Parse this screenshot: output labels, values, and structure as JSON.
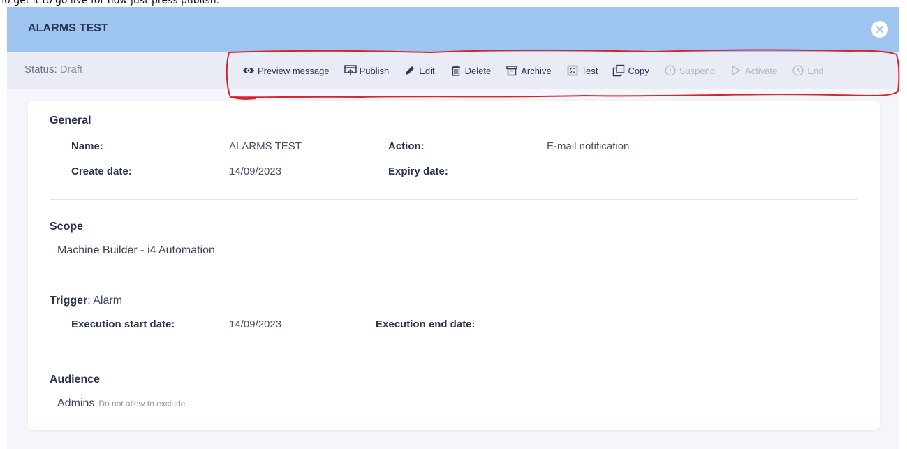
{
  "caption": "To get it to go live for now just press publish.",
  "header": {
    "title": "ALARMS TEST"
  },
  "status": {
    "label": "Status:",
    "value": "Draft"
  },
  "toolbar": [
    {
      "key": "preview",
      "label": "Preview message",
      "icon": "eye-icon",
      "enabled": true
    },
    {
      "key": "publish",
      "label": "Publish",
      "icon": "publish-icon",
      "enabled": true
    },
    {
      "key": "edit",
      "label": "Edit",
      "icon": "pencil-icon",
      "enabled": true
    },
    {
      "key": "delete",
      "label": "Delete",
      "icon": "trash-icon",
      "enabled": true
    },
    {
      "key": "archive",
      "label": "Archive",
      "icon": "archive-icon",
      "enabled": true
    },
    {
      "key": "test",
      "label": "Test",
      "icon": "checklist-icon",
      "enabled": true
    },
    {
      "key": "copy",
      "label": "Copy",
      "icon": "copy-icon",
      "enabled": true
    },
    {
      "key": "suspend",
      "label": "Suspend",
      "icon": "alert-circle-icon",
      "enabled": false
    },
    {
      "key": "activate",
      "label": "Activate",
      "icon": "play-icon",
      "enabled": false
    },
    {
      "key": "end",
      "label": "End",
      "icon": "clock-icon",
      "enabled": false
    }
  ],
  "general": {
    "title": "General",
    "name_label": "Name:",
    "name_value": "ALARMS TEST",
    "action_label": "Action:",
    "action_value": "E-mail notification",
    "create_label": "Create date:",
    "create_value": "14/09/2023",
    "expiry_label": "Expiry date:",
    "expiry_value": ""
  },
  "scope": {
    "title": "Scope",
    "value": "Machine Builder - i4 Automation"
  },
  "trigger": {
    "title": "Trigger",
    "type": ": Alarm",
    "start_label": "Execution start date:",
    "start_value": "14/09/2023",
    "end_label": "Execution end date:",
    "end_value": ""
  },
  "audience": {
    "title": "Audience",
    "value": "Admins",
    "note": "Do not allow to exclude"
  },
  "colors": {
    "header_bg": "#9ec5f0",
    "annotation": "#d9232b",
    "text_dark": "#2a3354",
    "disabled": "#b3b7c6"
  }
}
